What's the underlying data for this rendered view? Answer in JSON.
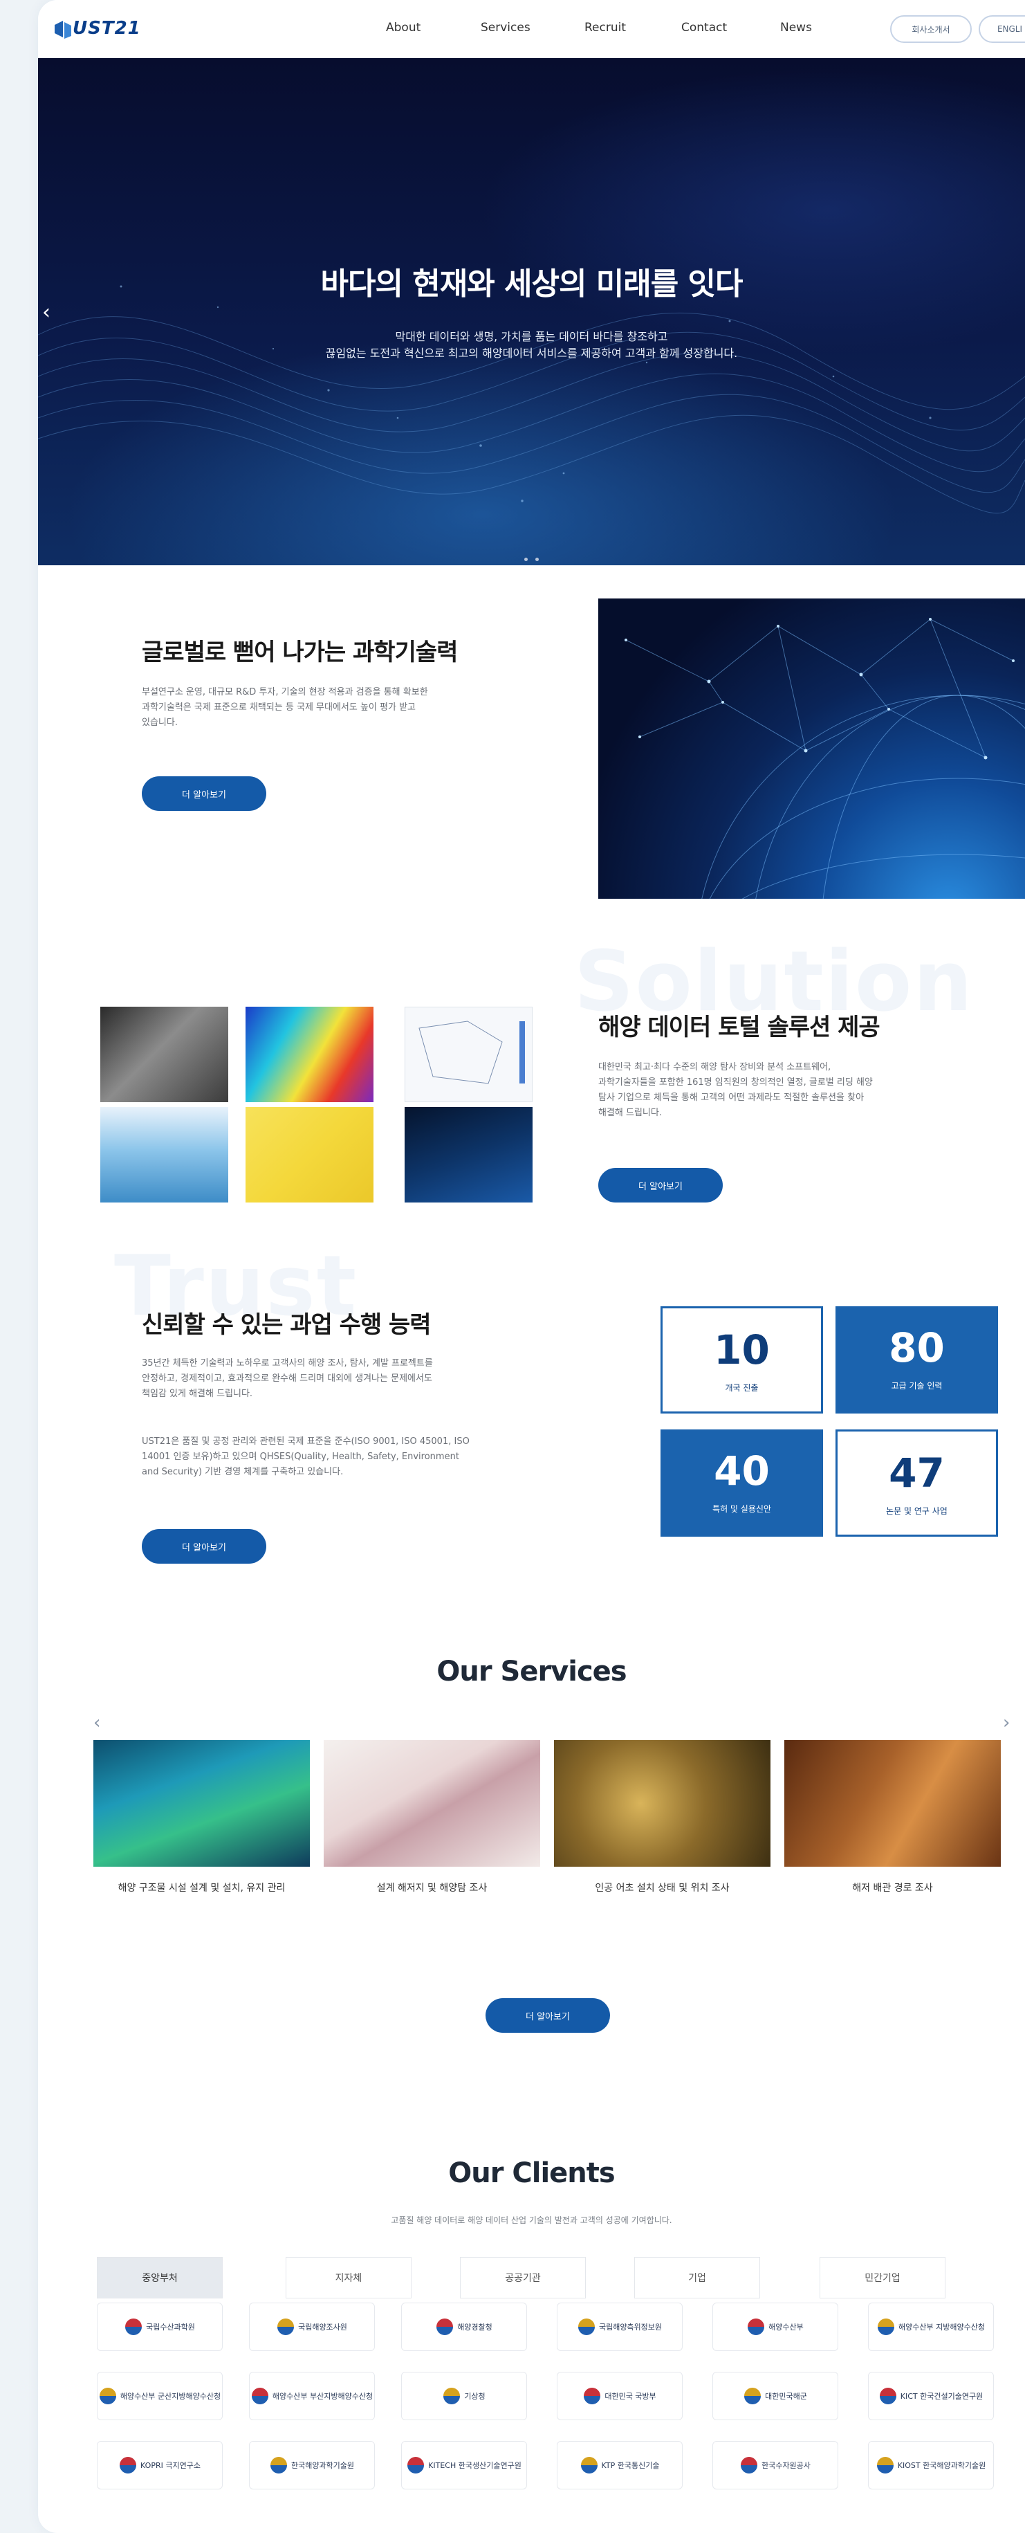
{
  "header": {
    "logo": "UST21",
    "nav": [
      "About",
      "Services",
      "Recruit",
      "Contact",
      "News"
    ],
    "intro_button": "회사소개서",
    "lang_button": "ENGLI"
  },
  "hero": {
    "title": "바다의 현재와 세상의 미래를 잇다",
    "subtitle_line1": "막대한 데이터와 생명, 가치를 품는 데이터 바다를 창조하고",
    "subtitle_line2": "끊임없는 도전과 혁신으로 최고의 해양데이터 서비스를 제공하여 고객과 함께 성장합니다."
  },
  "global": {
    "title": "글로벌로 뻗어 나가는 과학기술력",
    "desc": [
      "부설연구소 운영, 대규모 R&D 투자, 기술의 현장 적용과 검증을 통해 확보한",
      "과학기술력은 국제 표준으로 채택되는 등 국제 무대에서도 높이 평가 받고",
      "있습니다."
    ],
    "button": "더 알아보기"
  },
  "solution": {
    "bg_word": "Solution",
    "title": "해양 데이터 토털 솔루션 제공",
    "desc": [
      "대한민국 최고·최다 수준의 해양 탐사 장비와 분석 소프트웨어,",
      "과학기술자들을 포함한 161명 임직원의 창의적인 열정, 글로벌 리딩 해양",
      "탐사 기업으로 체득을 통해 고객의 어떤 과제라도 적절한 솔루션을 찾아",
      "해결해 드립니다."
    ],
    "button": "더 알아보기"
  },
  "trust": {
    "bg_word": "Trust",
    "title": "신뢰할 수 있는 과업 수행 능력",
    "desc1": [
      "35년간 체득한 기술력과 노하우로 고객사의 해양 조사, 탐사, 계발 프로젝트를",
      "안정하고, 경제적이고, 효과적으로 완수해 드리며 대외에 생겨나는 문제에서도",
      "책임감 있게 해결해 드립니다."
    ],
    "desc2": [
      "UST21은 품질 및 공정 관리와 관련된 국제 표준을 준수(ISO 9001, ISO 45001, ISO",
      "14001 인증 보유)하고 있으며 QHSES(Quality, Health, Safety, Environment",
      "and Security) 기반 경영 체계를 구축하고 있습니다."
    ],
    "button": "더 알아보기",
    "stats": [
      {
        "value": "10",
        "label": "개국 진출"
      },
      {
        "value": "80",
        "label": "고급 기술 인력"
      },
      {
        "value": "40",
        "label": "특허 및 실용신안"
      },
      {
        "value": "47",
        "label": "논문 및 연구 사업"
      }
    ]
  },
  "services": {
    "title": "Our Services",
    "items": [
      {
        "caption": "해양 구조물 시설 설계 및 설치, 유지 관리"
      },
      {
        "caption": "설계 해저지 및 해양탐 조사"
      },
      {
        "caption": "인공 어초 설치 상태 및 위치 조사"
      },
      {
        "caption": "해저 배관 경로 조사"
      }
    ],
    "button": "더 알아보기"
  },
  "clients": {
    "title": "Our Clients",
    "subtitle": "고품질 해양 데이터로 해양 데이터 산업 기술의 발전과 고객의 성공에 기여합니다.",
    "tabs": [
      "중앙부처",
      "지자체",
      "공공기관",
      "기업",
      "민간기업"
    ],
    "rows": [
      [
        "국립수산과학원",
        "국립해양조사원",
        "해양경찰청",
        "국립해양측위정보원",
        "해양수산부",
        "해양수산부 지방해양수산청"
      ],
      [
        "해양수산부 군산지방해양수산청",
        "해양수산부 부산지방해양수산청",
        "기상청",
        "대한민국 국방부",
        "대한민국해군",
        "KICT 한국건설기술연구원"
      ],
      [
        "KOPRI 극지연구소",
        "한국해양과학기술원",
        "KITECH 한국생산기술연구원",
        "KTP 한국통신기술",
        "한국수자원공사",
        "KIOST 한국해양과학기술원"
      ]
    ]
  },
  "colors": {
    "brand": "#145aa8",
    "stat_blue": "#1b63ae",
    "hero_dark": "#070d2e"
  }
}
